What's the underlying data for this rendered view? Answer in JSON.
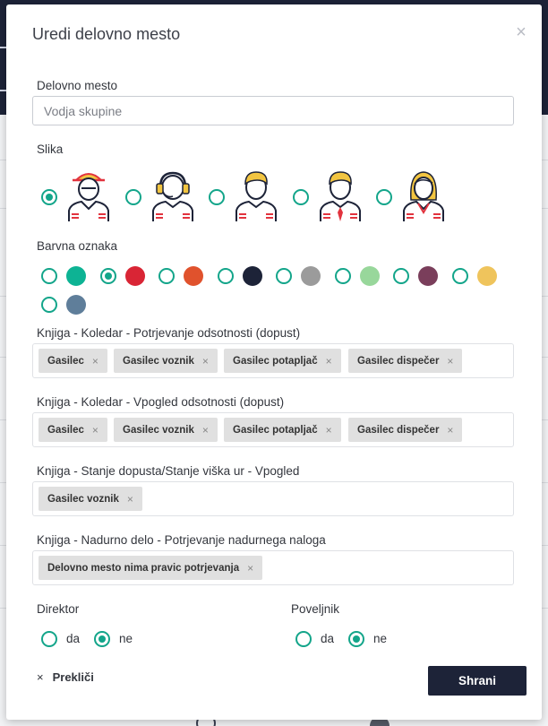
{
  "modal": {
    "title": "Uredi delovno mesto",
    "close_symbol": "×"
  },
  "position": {
    "label": "Delovno mesto",
    "placeholder": "Vodja skupine"
  },
  "image": {
    "label": "Slika",
    "options": [
      {
        "icon": "firefighter-helmet-icon",
        "selected": true
      },
      {
        "icon": "dispatcher-headset-icon",
        "selected": false
      },
      {
        "icon": "person-blond-icon",
        "selected": false
      },
      {
        "icon": "person-tie-icon",
        "selected": false
      },
      {
        "icon": "woman-blond-icon",
        "selected": false
      }
    ]
  },
  "color_tag": {
    "label": "Barvna oznaka",
    "options": [
      {
        "color": "#0db394",
        "selected": false
      },
      {
        "color": "#d92535",
        "selected": true
      },
      {
        "color": "#e0522d",
        "selected": false
      },
      {
        "color": "#1d2338",
        "selected": false
      },
      {
        "color": "#9b9b9b",
        "selected": false
      },
      {
        "color": "#98d79b",
        "selected": false
      },
      {
        "color": "#7a3e5b",
        "selected": false
      },
      {
        "color": "#efc45c",
        "selected": false
      },
      {
        "color": "#5f7e9a",
        "selected": false
      }
    ]
  },
  "permissions": [
    {
      "label": "Knjiga - Koledar - Potrjevanje odsotnosti (dopust)",
      "tags": [
        "Gasilec",
        "Gasilec voznik",
        "Gasilec potapljač",
        "Gasilec dispečer"
      ]
    },
    {
      "label": "Knjiga - Koledar - Vpogled odsotnosti (dopust)",
      "tags": [
        "Gasilec",
        "Gasilec voznik",
        "Gasilec potapljač",
        "Gasilec dispečer"
      ]
    },
    {
      "label": "Knjiga - Stanje dopusta/Stanje viška ur - Vpogled",
      "tags": [
        "Gasilec voznik"
      ]
    },
    {
      "label": "Knjiga - Nadurno delo - Potrjevanje nadurnega naloga",
      "tags": [
        "Delovno mesto nima pravic potrjevanja"
      ]
    }
  ],
  "tag_remove_symbol": "×",
  "director": {
    "label": "Direktor",
    "yes": "da",
    "no": "ne",
    "value": "ne"
  },
  "commander": {
    "label": "Poveljnik",
    "yes": "da",
    "no": "ne",
    "value": "ne"
  },
  "footer": {
    "cancel_symbol": "×",
    "cancel_label": "Prekliči",
    "save_label": "Shrani"
  }
}
